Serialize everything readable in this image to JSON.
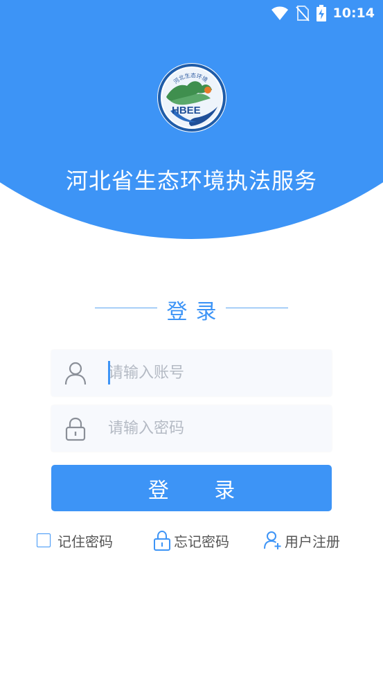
{
  "status_bar": {
    "time": "10:14",
    "icons": [
      "wifi-icon",
      "no-sim-icon",
      "battery-charging-icon"
    ]
  },
  "header": {
    "logo_text": "HBEE",
    "logo_arc_text": "河北生态环境",
    "title": "河北省生态环境执法服务"
  },
  "login": {
    "heading": "登录",
    "account_placeholder": "请输入账号",
    "password_placeholder": "请输入密码",
    "submit_label": "登 录"
  },
  "options": {
    "remember": "记住密码",
    "forgot": "忘记密码",
    "register": "用户注册"
  },
  "colors": {
    "primary": "#3d94f6",
    "field_bg": "#f7f9fd",
    "placeholder": "#b4bac4"
  }
}
